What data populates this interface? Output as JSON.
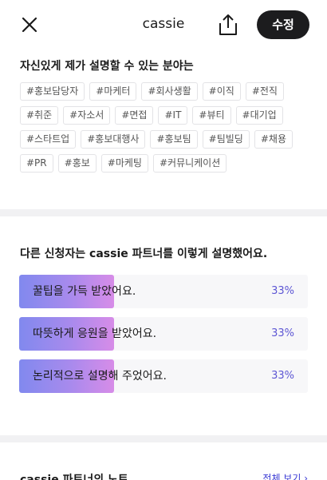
{
  "header": {
    "title": "cassie",
    "edit_label": "수정"
  },
  "expertise": {
    "title": "자신있게 제가 설명할 수 있는 분야는",
    "tags": [
      "#홍보담당자",
      "#마케터",
      "#회사생활",
      "#이직",
      "#전직",
      "#취준",
      "#자소서",
      "#면접",
      "#IT",
      "#뷰티",
      "#대기업",
      "#스타트업",
      "#홍보대행사",
      "#홍보팀",
      "#팀빌딩",
      "#채용",
      "#PR",
      "#홍보",
      "#마케팅",
      "#커뮤니케이션"
    ]
  },
  "feedback": {
    "title": "다른 신청자는 cassie 파트너를 이렇게 설명했어요.",
    "items": [
      {
        "label": "꿀팁을 가득 받았어요.",
        "percent_label": "33%",
        "percent": 33
      },
      {
        "label": "따뜻하게 응원을 받았어요.",
        "percent_label": "33%",
        "percent": 33
      },
      {
        "label": "논리적으로 설명해 주었어요.",
        "percent_label": "33%",
        "percent": 33
      }
    ],
    "accent_color": "#5d56d4"
  },
  "notes": {
    "title": "cassie 파트너의 노트",
    "see_all_label": "전체 보기 ›"
  }
}
